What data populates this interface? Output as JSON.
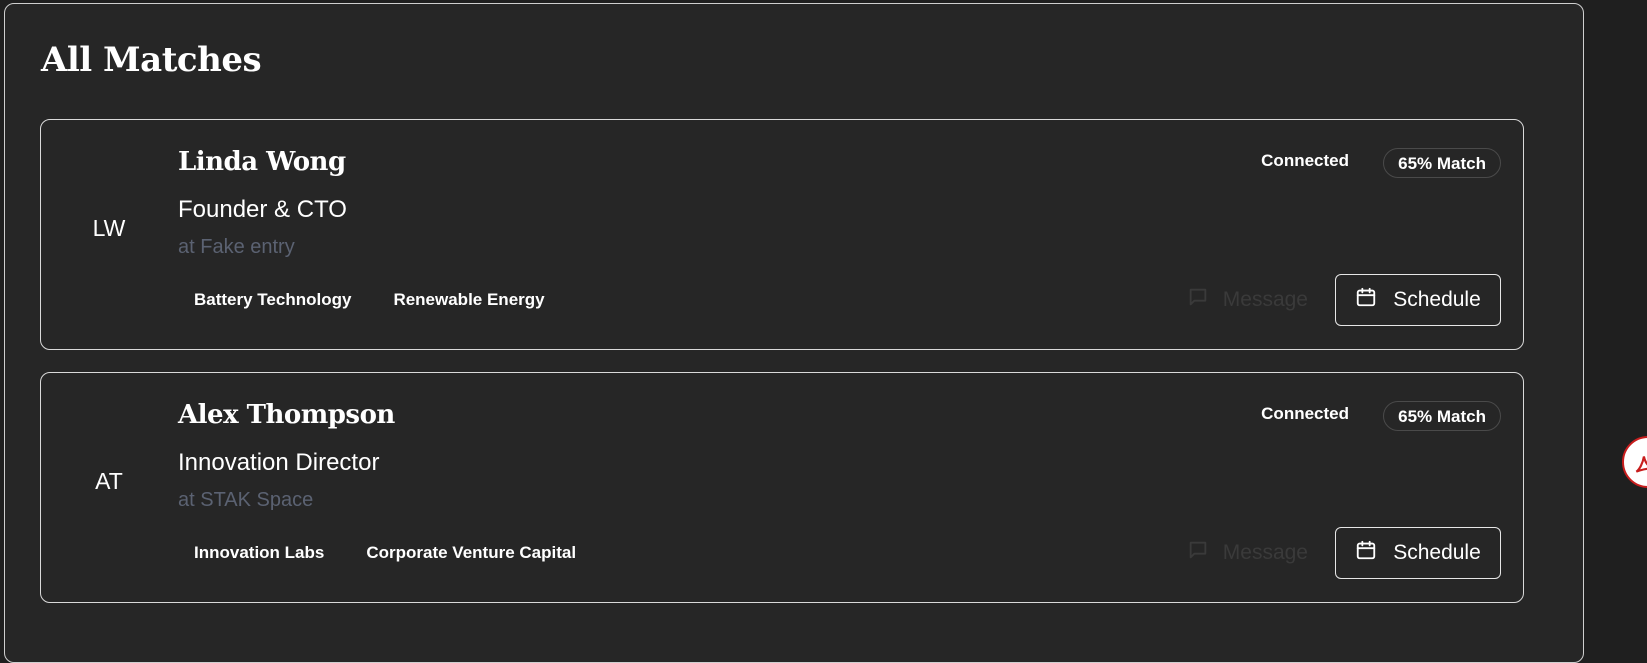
{
  "page": {
    "title": "All Matches"
  },
  "matches": [
    {
      "initials": "LW",
      "name": "Linda Wong",
      "role": "Founder & CTO",
      "company": "at Fake entry",
      "tags": [
        "Battery Technology",
        "Renewable Energy"
      ],
      "status": "Connected",
      "match": "65% Match",
      "message_label": "Message",
      "schedule_label": "Schedule"
    },
    {
      "initials": "AT",
      "name": "Alex Thompson",
      "role": "Innovation Director",
      "company": "at STAK Space",
      "tags": [
        "Innovation Labs",
        "Corporate Venture Capital"
      ],
      "status": "Connected",
      "match": "65% Match",
      "message_label": "Message",
      "schedule_label": "Schedule"
    }
  ],
  "icons": {
    "message": "message-square-icon",
    "schedule": "calendar-icon",
    "floating": "pdf-icon"
  },
  "colors": {
    "background": "#1f1f1f",
    "panel": "#262626",
    "muted_text": "#5b6272",
    "disabled_text": "#3a3a3a",
    "accent_red": "#c81d1d"
  }
}
